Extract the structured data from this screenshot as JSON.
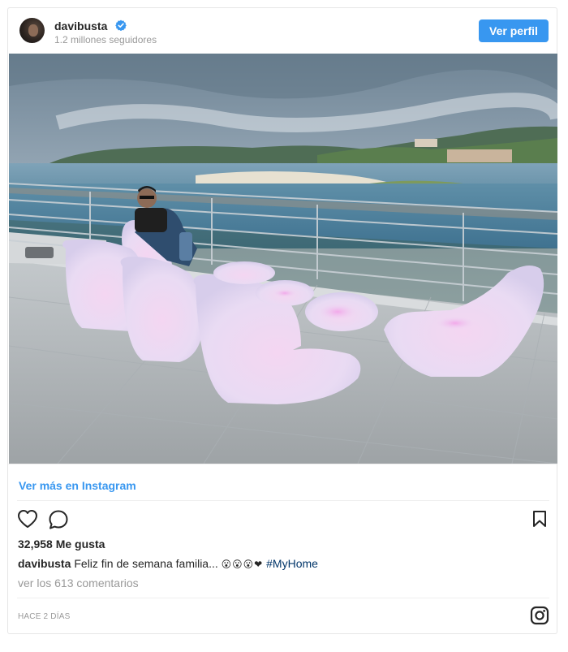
{
  "header": {
    "username": "davibusta",
    "followers": "1.2 millones seguidores",
    "profile_button": "Ver perfil",
    "verified_icon": "verified-badge-icon",
    "avatar": "avatar"
  },
  "photo": {
    "description_icon": "post-photo"
  },
  "links": {
    "more_on_instagram": "Ver más en Instagram"
  },
  "actions": {
    "like_icon": "heart-icon",
    "comment_icon": "comment-icon",
    "save_icon": "bookmark-icon"
  },
  "post": {
    "likes": "32,958 Me gusta",
    "caption_user": "davibusta",
    "caption_text": "Feliz fin de semana familia... ",
    "caption_emojis": "😮😮😮❤",
    "hashtag": "#MyHome",
    "comments_link": "ver los 613 comentarios",
    "timestamp": "HACE 2 DÍAS"
  },
  "footer": {
    "instagram_icon": "instagram-logo-icon"
  },
  "colors": {
    "accent": "#3897f0",
    "hashtag": "#003569",
    "muted": "#999999",
    "text": "#262626"
  }
}
